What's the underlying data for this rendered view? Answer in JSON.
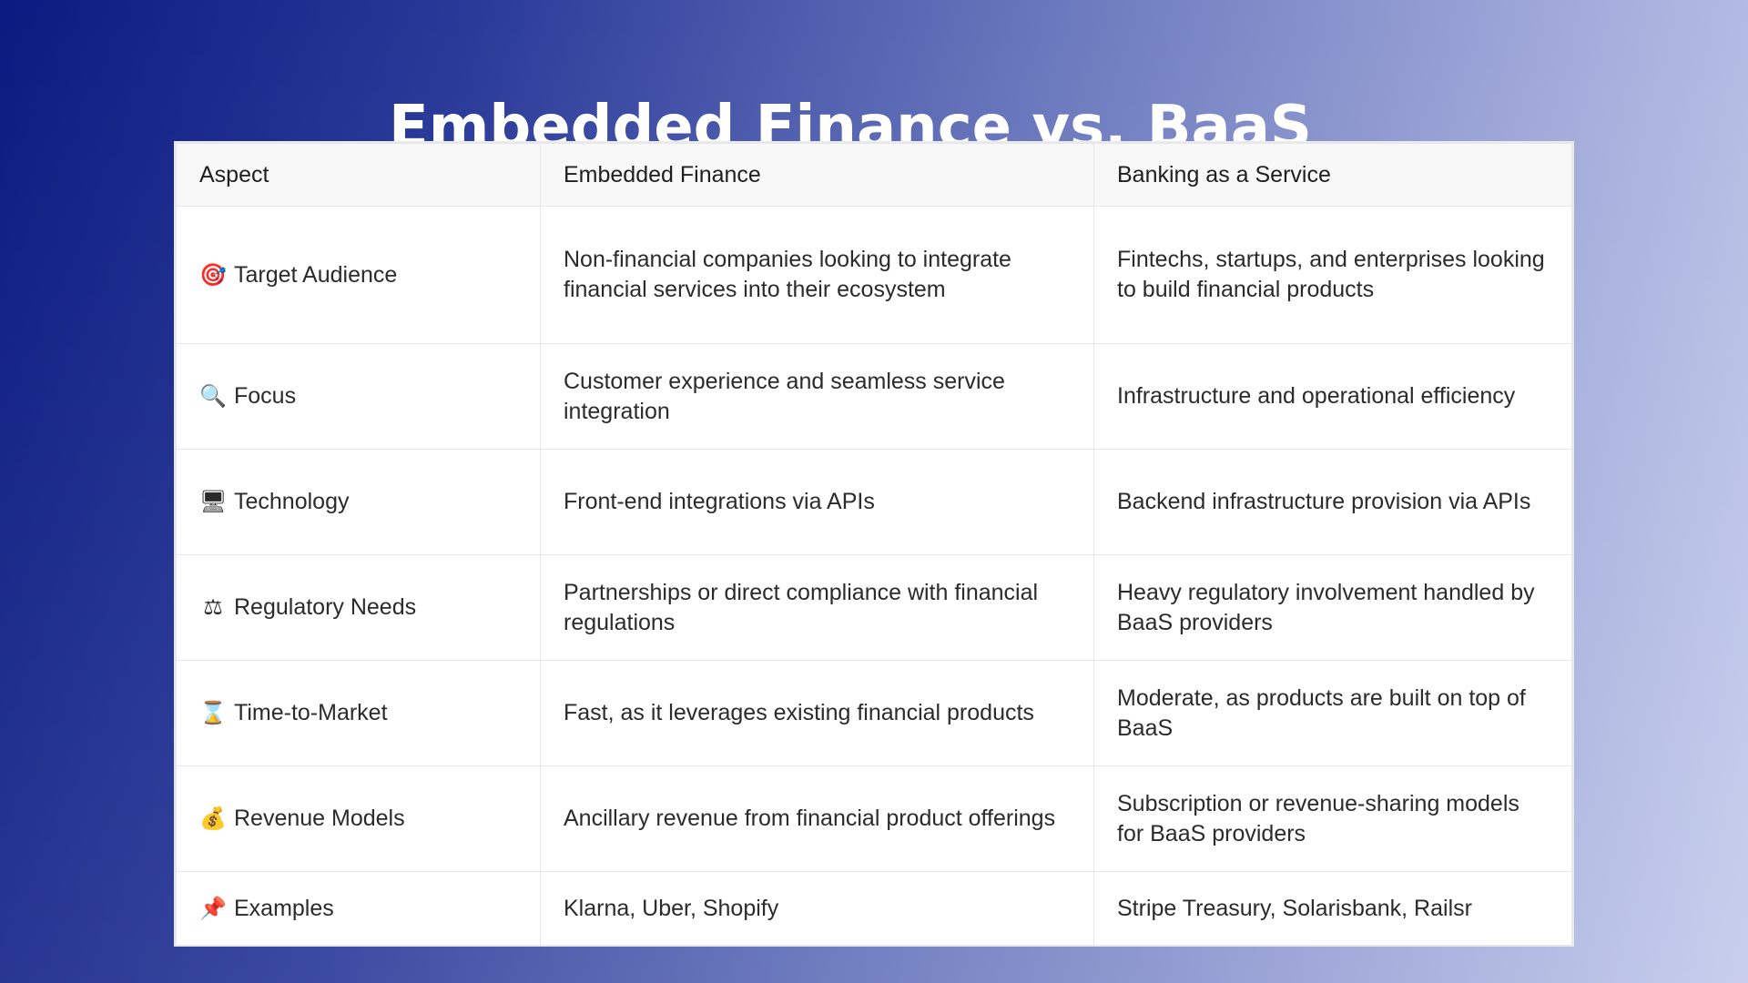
{
  "title": "Embedded Finance vs. BaaS",
  "table": {
    "headers": [
      "Aspect",
      "Embedded Finance",
      "Banking as a Service"
    ],
    "rows": [
      {
        "icon": "target-icon",
        "glyph": "🎯",
        "aspect": "Target Audience",
        "embedded": "Non-financial companies looking to integrate financial services into their ecosystem",
        "baas": "Fintechs, startups, and enterprises looking to build financial products"
      },
      {
        "icon": "magnifying-glass-icon",
        "glyph": "🔍",
        "aspect": "Focus",
        "embedded": "Customer experience and seamless service integration",
        "baas": "Infrastructure and operational efficiency"
      },
      {
        "icon": "computer-monitor-icon",
        "glyph": "🖥",
        "aspect": "Technology",
        "embedded": "Front-end integrations via APIs",
        "baas": "Backend infrastructure provision via APIs"
      },
      {
        "icon": "balance-scale-icon",
        "glyph": "⚖",
        "aspect": "Regulatory Needs",
        "embedded": "Partnerships or direct compliance with financial regulations",
        "baas": "Heavy regulatory involvement handled by BaaS providers"
      },
      {
        "icon": "hourglass-icon",
        "glyph": "⌛",
        "aspect": "Time-to-Market",
        "embedded": "Fast, as it leverages existing financial products",
        "baas": "Moderate, as products are built on top of BaaS"
      },
      {
        "icon": "money-bag-icon",
        "glyph": "💰",
        "aspect": "Revenue Models",
        "embedded": "Ancillary revenue from financial product offerings",
        "baas": "Subscription or revenue-sharing models for BaaS providers"
      },
      {
        "icon": "pushpin-icon",
        "glyph": "📌",
        "aspect": "Examples",
        "embedded": "Klarna, Uber, Shopify",
        "baas": "Stripe Treasury, Solarisbank, Railsr"
      }
    ]
  }
}
